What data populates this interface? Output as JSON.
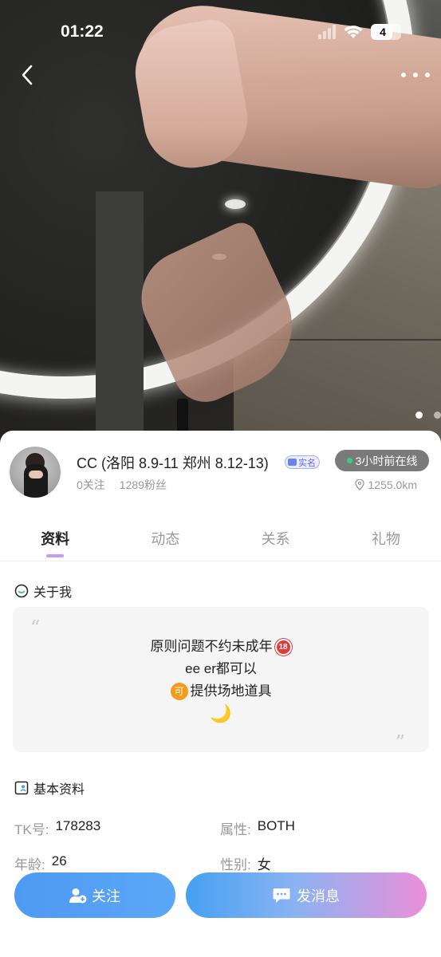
{
  "status_bar": {
    "time": "01:22",
    "battery": "4"
  },
  "profile": {
    "name": "CC (洛阳 8.9-11 郑州 8.12-13)",
    "verified_label": "实名",
    "online_status": "3小时前在线",
    "following": "0关注",
    "fans": "1289粉丝",
    "distance": "1255.0km"
  },
  "tabs": [
    {
      "label": "资料",
      "active": true
    },
    {
      "label": "动态"
    },
    {
      "label": "关系"
    },
    {
      "label": "礼物"
    }
  ],
  "about": {
    "title": "关于我",
    "open_quote": "“",
    "close_quote": "”",
    "line1": "原则问题不约未成年",
    "line2": "ee er都可以",
    "line3": "提供场地道具",
    "emoji_18": "18",
    "emoji_ke": "可",
    "moon": "🌙"
  },
  "basic": {
    "title": "基本资料",
    "rows": [
      {
        "label_a": "TK号:",
        "value_a": "178283",
        "label_b": "属性:",
        "value_b": "BOTH"
      },
      {
        "label_a": "年龄:",
        "value_a": "26",
        "label_b": "性别:",
        "value_b": "女"
      }
    ]
  },
  "actions": {
    "follow": "关注",
    "message": "发消息"
  },
  "colors": {
    "tab_underline": "#c99bf4",
    "follow_button": "#4d9af2",
    "message_gradient_start": "#46a0f2",
    "message_gradient_end": "#eb8fd8",
    "online_dot": "#35d07f"
  },
  "carousel": {
    "current_page": 1,
    "total_pages": 2
  }
}
